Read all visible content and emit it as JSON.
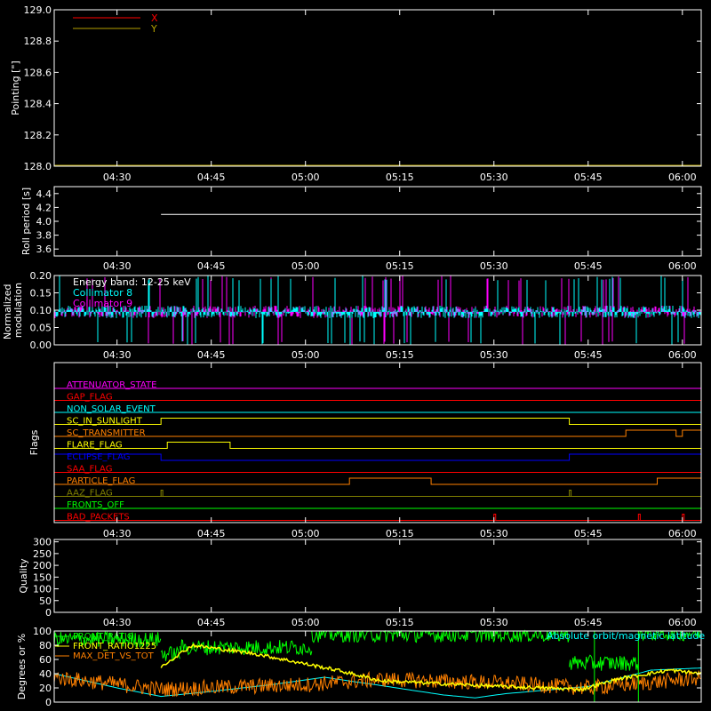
{
  "time_ticks": [
    "04:30",
    "04:45",
    "05:00",
    "05:15",
    "05:30",
    "05:45",
    "06:00"
  ],
  "time_range": [
    "04:20",
    "06:03"
  ],
  "chart_data": [
    {
      "type": "line",
      "ylabel": "Pointing [\"]",
      "ylim": [
        128.0,
        129.0
      ],
      "yticks": [
        "128.0",
        "128.2",
        "128.4",
        "128.6",
        "128.8",
        "129.0"
      ],
      "legend": [
        {
          "name": "X",
          "color": "#ff0000"
        },
        {
          "name": "Y",
          "color": "#b4a000"
        }
      ],
      "series": [
        {
          "name": "X",
          "color": "#ff0000",
          "values": []
        },
        {
          "name": "Y",
          "color": "#b4a000",
          "values": []
        }
      ]
    },
    {
      "type": "line",
      "ylabel": "Roll period [s]",
      "ylim": [
        3.5,
        4.5
      ],
      "yticks": [
        "3.6",
        "3.8",
        "4.0",
        "4.2",
        "4.4"
      ],
      "series": [
        {
          "color": "#ffffff",
          "values": [
            4.1,
            4.1
          ]
        }
      ]
    },
    {
      "type": "line",
      "ylabel": "Normalized modulation",
      "ylim": [
        0.0,
        0.2
      ],
      "yticks": [
        "0.00",
        "0.05",
        "0.10",
        "0.15",
        "0.20"
      ],
      "annotation": "Energy band: 12-25 keV",
      "legend": [
        {
          "name": "Collimator 8",
          "color": "#00ffff"
        },
        {
          "name": "Collimator 9",
          "color": "#ff00ff"
        }
      ],
      "baseline": 0.095
    },
    {
      "type": "line",
      "ylabel": "Flags",
      "flags": [
        {
          "name": "ATTENUATOR_STATE",
          "color": "#ff00ff",
          "steps": [
            [
              "04:20",
              0
            ]
          ]
        },
        {
          "name": "GAP_FLAG",
          "color": "#ff0000",
          "steps": [
            [
              "04:20",
              0
            ]
          ]
        },
        {
          "name": "NON_SOLAR_EVENT",
          "color": "#00ffff",
          "steps": [
            [
              "04:20",
              0
            ]
          ]
        },
        {
          "name": "SC_IN_SUNLIGHT",
          "color": "#ffff00",
          "steps": [
            [
              "04:20",
              0
            ],
            [
              "04:37",
              1
            ],
            [
              "05:42",
              0
            ]
          ]
        },
        {
          "name": "SC_TRANSMITTER",
          "color": "#ff8000",
          "steps": [
            [
              "04:20",
              0
            ],
            [
              "05:51",
              1
            ],
            [
              "05:59",
              0
            ],
            [
              "06:00",
              1
            ]
          ]
        },
        {
          "name": "FLARE_FLAG",
          "color": "#ffff00",
          "steps": [
            [
              "04:20",
              0
            ],
            [
              "04:38",
              1
            ],
            [
              "04:48",
              0
            ]
          ]
        },
        {
          "name": "ECLIPSE_FLAG",
          "color": "#0000ff",
          "steps": [
            [
              "04:20",
              1
            ],
            [
              "04:37",
              0
            ],
            [
              "05:42",
              1
            ]
          ]
        },
        {
          "name": "SAA_FLAG",
          "color": "#ff0000",
          "steps": [
            [
              "04:20",
              0
            ]
          ]
        },
        {
          "name": "PARTICLE_FLAG",
          "color": "#ff8000",
          "steps": [
            [
              "04:20",
              0
            ],
            [
              "05:07",
              1
            ],
            [
              "05:20",
              0
            ],
            [
              "05:56",
              1
            ]
          ]
        },
        {
          "name": "AAZ_FLAG",
          "color": "#808000",
          "pulses": [
            "04:37",
            "05:42"
          ]
        },
        {
          "name": "FRONTS_OFF",
          "color": "#00ff00",
          "steps": [
            [
              "04:20",
              0
            ]
          ]
        },
        {
          "name": "BAD_PACKETS",
          "color": "#ff0000",
          "pulses": [
            "05:30",
            "05:53",
            "06:00"
          ]
        }
      ]
    },
    {
      "type": "line",
      "ylabel": "Quality",
      "ylim": [
        0,
        310
      ],
      "yticks": [
        "0",
        "50",
        "100",
        "150",
        "200",
        "250",
        "300"
      ],
      "series": []
    },
    {
      "type": "line",
      "ylabel": "Degrees or %",
      "ylim": [
        0,
        100
      ],
      "yticks": [
        "0",
        "20",
        "40",
        "60",
        "80",
        "100"
      ],
      "legend": [
        {
          "name": "FRONT_RATIO",
          "color": "#00ff00"
        },
        {
          "name": "FRONT_RATIO1225",
          "color": "#ffff00"
        },
        {
          "name": "MAX_DET_VS_TOT",
          "color": "#ff8000"
        }
      ],
      "annotation": "Absolute orbit/magnetic latitude",
      "annotation_color": "#00ffff",
      "series": [
        {
          "name": "FRONT_RATIO",
          "color": "#00ff00",
          "segments": [
            [
              "04:20",
              "04:37",
              88
            ],
            [
              "04:37",
              "04:40",
              68
            ],
            [
              "04:40",
              "05:01",
              77
            ],
            [
              "05:01",
              "05:31",
              95
            ],
            [
              "05:31",
              "05:42",
              95
            ],
            [
              "05:42",
              "05:53",
              55
            ],
            [
              "05:53",
              "06:03",
              97
            ]
          ]
        },
        {
          "name": "FRONT_RATIO1225",
          "color": "#ffff00",
          "points": [
            [
              "04:37",
              50
            ],
            [
              "04:42",
              80
            ],
            [
              "04:52",
              68
            ],
            [
              "05:01",
              52
            ],
            [
              "05:05",
              45
            ],
            [
              "05:12",
              30
            ],
            [
              "05:31",
              22
            ],
            [
              "05:44",
              18
            ],
            [
              "05:50",
              33
            ],
            [
              "05:58",
              45
            ],
            [
              "06:03",
              40
            ]
          ]
        },
        {
          "name": "MAX_DET_VS_TOT",
          "color": "#ff8000",
          "points": [
            [
              "04:20",
              35
            ],
            [
              "04:37",
              18
            ],
            [
              "05:01",
              25
            ],
            [
              "05:12",
              32
            ],
            [
              "05:31",
              27
            ],
            [
              "05:45",
              20
            ],
            [
              "06:03",
              34
            ]
          ]
        },
        {
          "name": "Absolute orbit/magnetic latitude",
          "color": "#00ffff",
          "points": [
            [
              "04:20",
              40
            ],
            [
              "04:30",
              20
            ],
            [
              "04:37",
              8
            ],
            [
              "04:45",
              15
            ],
            [
              "04:55",
              25
            ],
            [
              "05:03",
              35
            ],
            [
              "05:13",
              22
            ],
            [
              "05:22",
              10
            ],
            [
              "05:27",
              6
            ],
            [
              "05:32",
              12
            ],
            [
              "05:45",
              22
            ],
            [
              "05:55",
              45
            ],
            [
              "06:03",
              48
            ]
          ]
        }
      ]
    }
  ]
}
